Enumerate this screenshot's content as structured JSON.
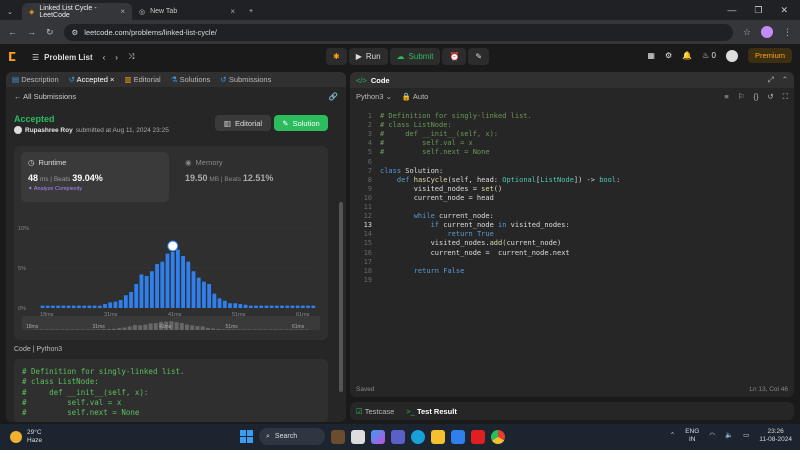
{
  "browser": {
    "tabs": [
      {
        "title": "Linked List Cycle - LeetCode",
        "active": true
      },
      {
        "title": "New Tab",
        "active": false
      }
    ],
    "url": "leetcode.com/problems/linked-list-cycle/"
  },
  "nav": {
    "problem_list": "Problem List",
    "run": "Run",
    "submit": "Submit",
    "streak": "0",
    "premium": "Premium"
  },
  "left": {
    "tabs": [
      "Description",
      "Accepted",
      "Editorial",
      "Solutions",
      "Submissions"
    ],
    "all_submissions": "All Submissions",
    "status": "Accepted",
    "user": "Rupashree Roy",
    "submitted_at": "submitted at Aug 11, 2024 23:25",
    "editorial_btn": "Editorial",
    "solution_btn": "Solution",
    "runtime": {
      "label": "Runtime",
      "value": "48",
      "unit": "ms",
      "beats_label": "Beats",
      "beats": "39.04%",
      "analyze": "Analyze Complexity"
    },
    "memory": {
      "label": "Memory",
      "value": "19.50",
      "unit": "MB",
      "beats_label": "Beats",
      "beats": "12.51%"
    },
    "code_lang": "Code",
    "code_lang_name": "Python3",
    "code_preview": "# Definition for singly-linked list.\n# class ListNode:\n#     def __init__(self, x):\n#         self.val = x\n#         self.next = None"
  },
  "chart_data": {
    "type": "bar",
    "y_ticks": [
      "10%",
      "5%",
      "0%"
    ],
    "ylim": [
      0,
      10
    ],
    "x_ticks": [
      "18ms",
      "31ms",
      "41ms",
      "51ms",
      "61ms"
    ],
    "mini_ticks": [
      "18ms",
      "31ms",
      "41ms",
      "51ms",
      "61ms"
    ],
    "highlight_index": 25,
    "values": [
      0.3,
      0.3,
      0.3,
      0.3,
      0.3,
      0.3,
      0.3,
      0.3,
      0.3,
      0.3,
      0.3,
      0.3,
      0.5,
      0.7,
      0.8,
      1.0,
      1.6,
      2.0,
      3.0,
      4.2,
      4.0,
      4.6,
      5.5,
      5.8,
      6.8,
      7.0,
      7.3,
      6.5,
      5.8,
      4.6,
      3.8,
      3.3,
      3.0,
      1.8,
      1.2,
      0.9,
      0.6,
      0.6,
      0.5,
      0.4,
      0.3,
      0.3,
      0.3,
      0.3,
      0.3,
      0.3,
      0.3,
      0.3,
      0.3,
      0.3,
      0.3,
      0.3,
      0.3
    ],
    "color": "#2f80ed"
  },
  "right": {
    "title": "Code",
    "language": "Python3",
    "auto": "Auto",
    "code_lines": [
      "# Definition for singly-linked list.",
      "# class ListNode:",
      "#     def __init__(self, x):",
      "#         self.val = x",
      "#         self.next = None",
      "",
      "class Solution:",
      "    def hasCycle(self, head: Optional[ListNode]) -> bool:",
      "        visited_nodes = set()",
      "        current_node = head",
      "",
      "        while current_node:",
      "            if current_node in visited_nodes:",
      "                return True",
      "            visited_nodes.add(current_node)",
      "            current_node =  current_node.next",
      "",
      "        return False",
      ""
    ],
    "saved": "Saved",
    "cursor": "Ln 13, Col 46"
  },
  "bottom": {
    "testcase": "Testcase",
    "test_result": "Test Result"
  },
  "taskbar": {
    "temp": "29°C",
    "weather": "Haze",
    "search": "Search",
    "lang": "ENG",
    "region": "IN",
    "time": "23:26",
    "date": "11-08-2024"
  }
}
